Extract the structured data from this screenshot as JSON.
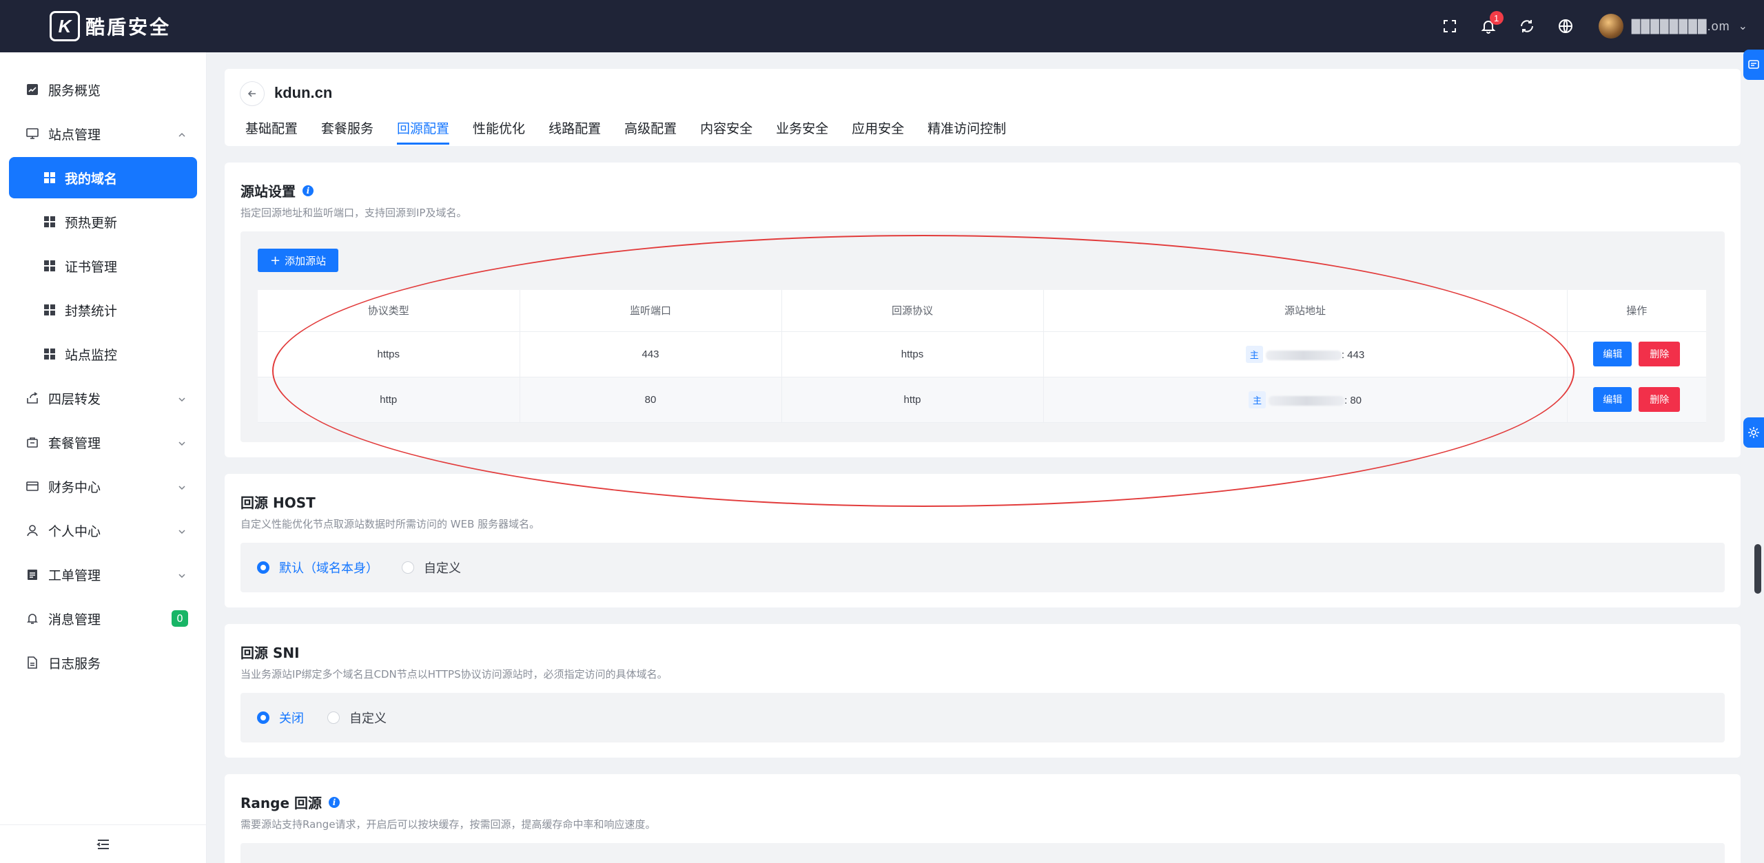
{
  "brand": {
    "name": "酷盾安全",
    "mark": "K"
  },
  "header": {
    "notification_count": "1",
    "user_name": "████████.om"
  },
  "sidebar": {
    "items": [
      {
        "label": "服务概览"
      },
      {
        "label": "站点管理"
      },
      {
        "label": "四层转发"
      },
      {
        "label": "套餐管理"
      },
      {
        "label": "财务中心"
      },
      {
        "label": "个人中心"
      },
      {
        "label": "工单管理"
      },
      {
        "label": "消息管理",
        "badge": "0"
      },
      {
        "label": "日志服务"
      }
    ],
    "site_sub": [
      {
        "label": "我的域名"
      },
      {
        "label": "预热更新"
      },
      {
        "label": "证书管理"
      },
      {
        "label": "封禁统计"
      },
      {
        "label": "站点监控"
      }
    ]
  },
  "page": {
    "domain": "kdun.cn",
    "tabs": [
      "基础配置",
      "套餐服务",
      "回源配置",
      "性能优化",
      "线路配置",
      "高级配置",
      "内容安全",
      "业务安全",
      "应用安全",
      "精准访问控制"
    ],
    "active_tab": "回源配置"
  },
  "origin": {
    "title": "源站设置",
    "desc": "指定回源地址和监听端口，支持回源到IP及域名。",
    "add_button": "添加源站",
    "columns": [
      "协议类型",
      "监听端口",
      "回源协议",
      "源站地址",
      "操作"
    ],
    "rows": [
      {
        "protocol": "https",
        "port": "443",
        "back_protocol": "https",
        "tag": "主",
        "addr_port": ": 443"
      },
      {
        "protocol": "http",
        "port": "80",
        "back_protocol": "http",
        "tag": "主",
        "addr_port": ": 80"
      }
    ],
    "edit_label": "编辑",
    "delete_label": "删除"
  },
  "host": {
    "title": "回源 HOST",
    "desc": "自定义性能优化节点取源站数据时所需访问的 WEB 服务器域名。",
    "options": [
      "默认（域名本身）",
      "自定义"
    ]
  },
  "sni": {
    "title": "回源 SNI",
    "desc": "当业务源站IP绑定多个域名且CDN节点以HTTPS协议访问源站时，必须指定访问的具体域名。",
    "options": [
      "关闭",
      "自定义"
    ]
  },
  "range": {
    "title": "Range 回源",
    "desc": "需要源站支持Range请求，开启后可以按块缓存，按需回源，提高缓存命中率和响应速度。"
  },
  "colors": {
    "primary": "#1677ff",
    "danger": "#f2304a",
    "header_bg": "#1f2437",
    "annotation": "#e23b3b"
  }
}
